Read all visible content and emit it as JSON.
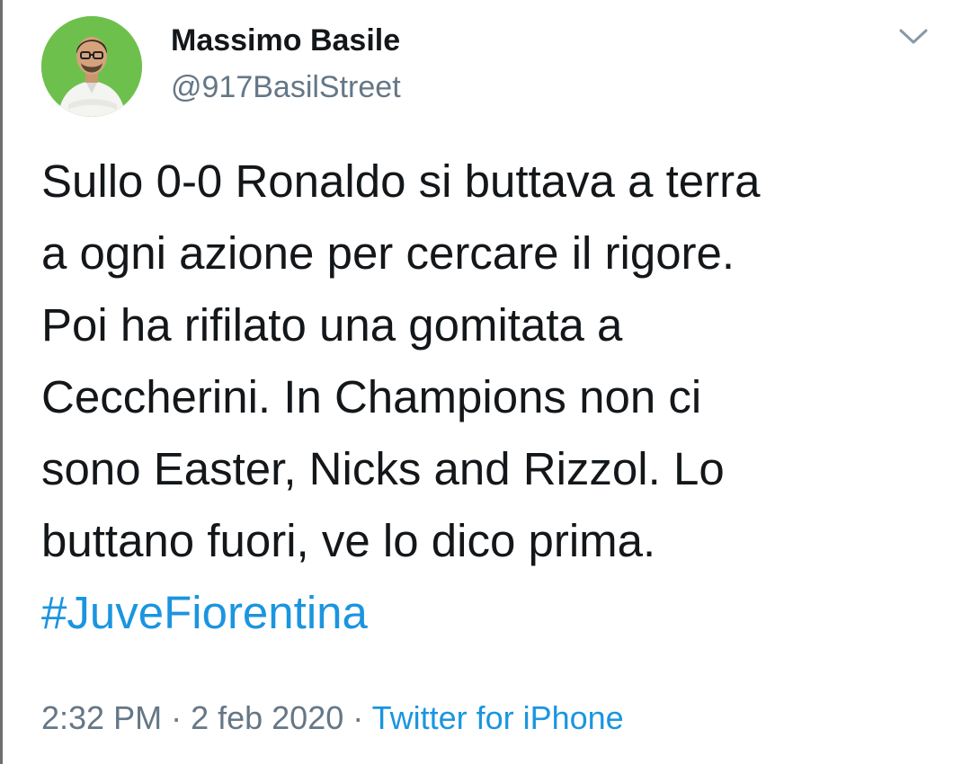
{
  "author": {
    "display_name": "Massimo Basile",
    "handle": "@917BasilStreet"
  },
  "tweet": {
    "text": "Sullo 0-0 Ronaldo si buttava a terra\na ogni azione per cercare il rigore.\nPoi ha rifilato una gomitata a\nCeccherini. In Champions non ci\nsono Easter, Nicks and Rizzol. Lo\nbuttano fuori, ve lo dico prima.\n",
    "hashtag": "#JuveFiorentina"
  },
  "meta": {
    "time": "2:32 PM",
    "separator": " · ",
    "date": "2 feb 2020",
    "source": "Twitter for iPhone"
  },
  "icons": {
    "menu": "chevron-down-icon",
    "avatar": "profile-photo"
  },
  "colors": {
    "link": "#1b95e0",
    "secondary_text": "#657786",
    "primary_text": "#14171a",
    "avatar_background": "#6ec04d"
  }
}
